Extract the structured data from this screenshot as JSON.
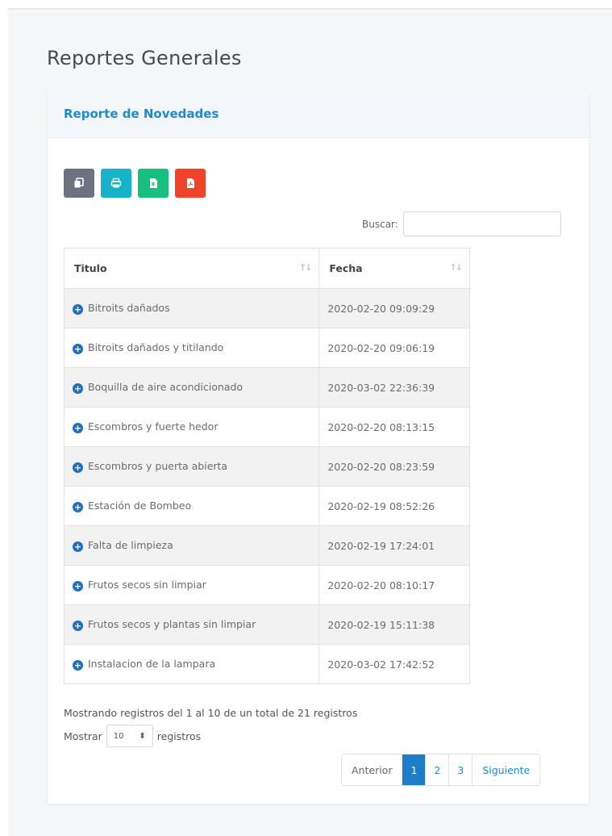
{
  "page": {
    "title": "Reportes Generales"
  },
  "card": {
    "title": "Reporte de Novedades"
  },
  "toolbar": {
    "buttons": [
      {
        "name": "copy",
        "icon": "copy-icon",
        "color": "#6c7280"
      },
      {
        "name": "print",
        "icon": "print-icon",
        "color": "#17b3c9"
      },
      {
        "name": "excel",
        "icon": "excel-file-icon",
        "color": "#18c07f"
      },
      {
        "name": "pdf",
        "icon": "pdf-file-icon",
        "color": "#f0432b"
      }
    ]
  },
  "search": {
    "label": "Buscar:",
    "value": ""
  },
  "table": {
    "headers": [
      "Titulo",
      "Fecha"
    ],
    "rows": [
      {
        "titulo": "Bitroits dañados",
        "fecha": "2020-02-20 09:09:29"
      },
      {
        "titulo": "Bitroits dañados y titilando",
        "fecha": "2020-02-20 09:06:19"
      },
      {
        "titulo": "Boquilla de aire acondicionado",
        "fecha": "2020-03-02 22:36:39"
      },
      {
        "titulo": "Escombros y fuerte hedor",
        "fecha": "2020-02-20 08:13:15"
      },
      {
        "titulo": "Escombros y puerta abierta",
        "fecha": "2020-02-20 08:23:59"
      },
      {
        "titulo": "Estación de Bombeo",
        "fecha": "2020-02-19 08:52:26"
      },
      {
        "titulo": "Falta de limpieza",
        "fecha": "2020-02-19 17:24:01"
      },
      {
        "titulo": "Frutos secos sin limpiar",
        "fecha": "2020-02-20 08:10:17"
      },
      {
        "titulo": "Frutos secos y plantas sin limpiar",
        "fecha": "2020-02-19 15:11:38"
      },
      {
        "titulo": "Instalacion de la lampara",
        "fecha": "2020-03-02 17:42:52"
      }
    ]
  },
  "footer": {
    "info": "Mostrando registros del 1 al 10 de un total de 21 registros",
    "length_prefix": "Mostrar",
    "length_value": "10",
    "length_suffix": "registros"
  },
  "pagination": {
    "previous": "Anterior",
    "pages": [
      "1",
      "2",
      "3"
    ],
    "active_page": "1",
    "next": "Siguiente"
  },
  "colors": {
    "accent": "#1e8bd0",
    "active_page": "#1e7dc8",
    "expand_icon": "#1e6fc0"
  }
}
